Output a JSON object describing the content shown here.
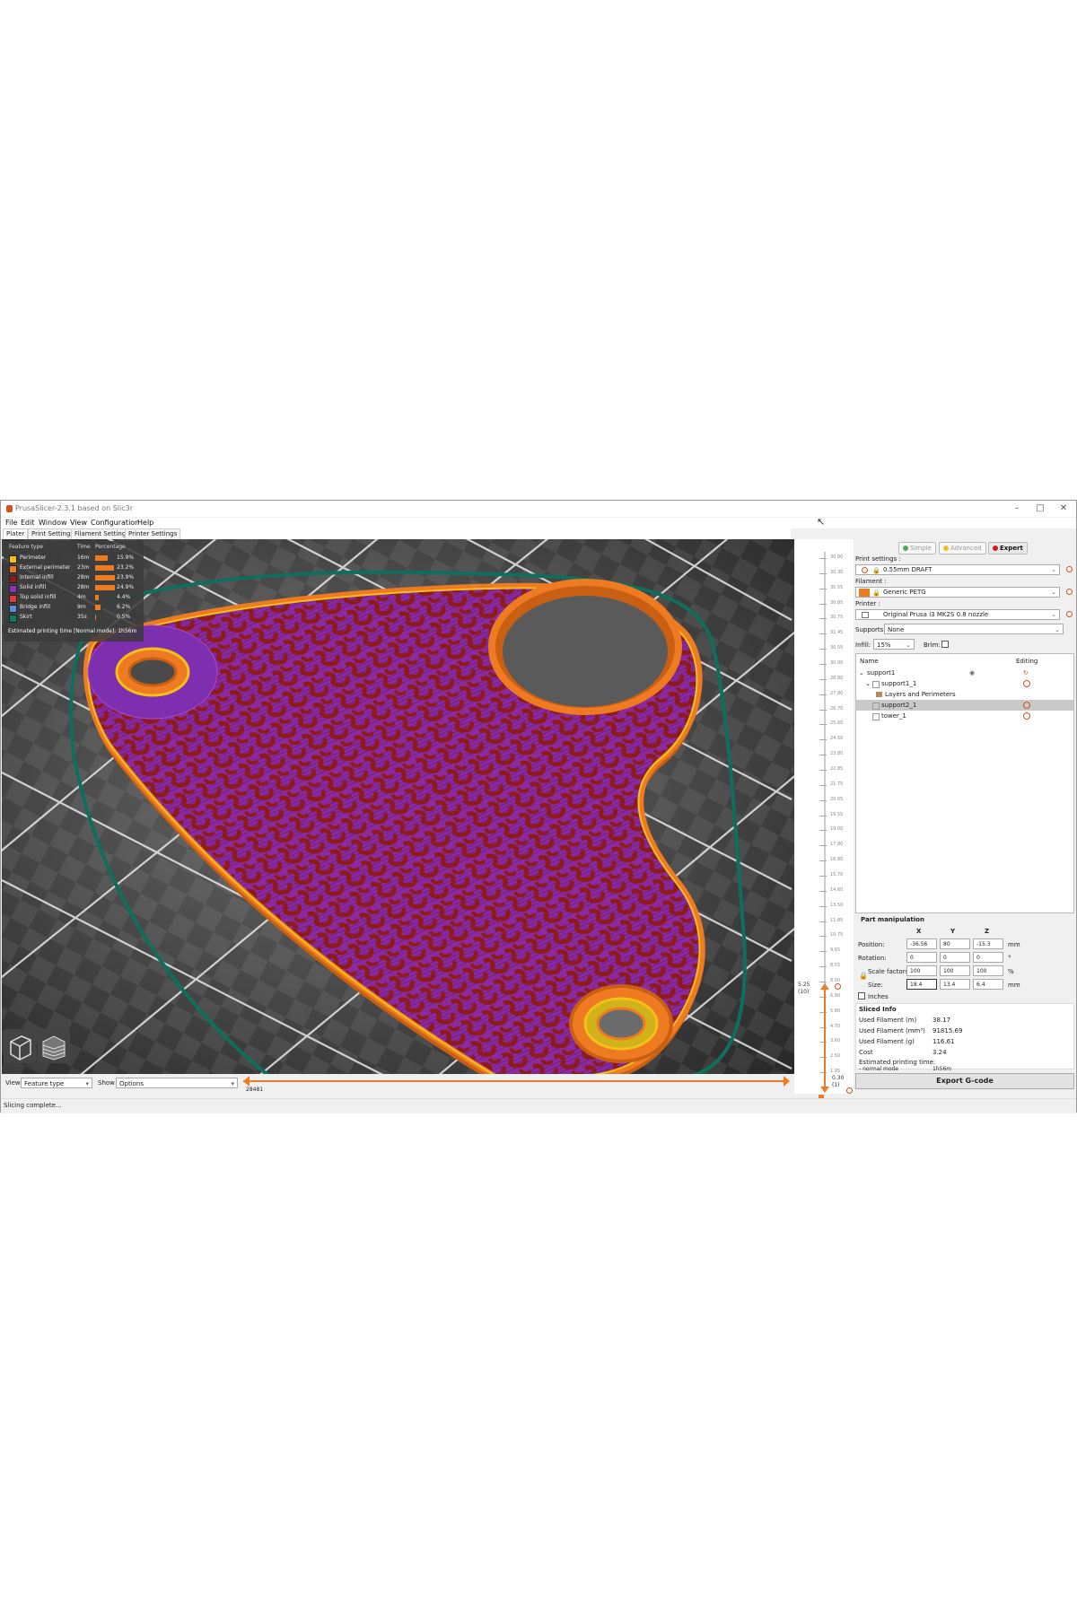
{
  "window": {
    "title": "PrusaSlicer-2.3.1 based on Slic3r",
    "controls": [
      "–",
      "□",
      "✕"
    ]
  },
  "menu": [
    "File",
    "Edit",
    "Window",
    "View",
    "Configuration",
    "Help"
  ],
  "tabs": [
    "Plater",
    "Print Settings",
    "Filament Settings",
    "Printer Settings"
  ],
  "legend": {
    "headers": [
      "Feature type",
      "Time",
      "Percentage"
    ],
    "rows": [
      {
        "label": "Perimeter",
        "time": "16m",
        "pct": "15.9%",
        "fraction": 0.159,
        "color": "#f3c019"
      },
      {
        "label": "External perimeter",
        "time": "23m",
        "pct": "23.2%",
        "fraction": 0.232,
        "color": "#ee7b22"
      },
      {
        "label": "Internal infill",
        "time": "28m",
        "pct": "23.9%",
        "fraction": 0.239,
        "color": "#8d1b1b"
      },
      {
        "label": "Solid infill",
        "time": "28m",
        "pct": "24.9%",
        "fraction": 0.249,
        "color": "#8f2fc4"
      },
      {
        "label": "Top solid infill",
        "time": "4m",
        "pct": "4.4%",
        "fraction": 0.044,
        "color": "#e23a3a"
      },
      {
        "label": "Bridge infill",
        "time": "9m",
        "pct": "6.2%",
        "fraction": 0.062,
        "color": "#5b8ed8"
      },
      {
        "label": "Skirt",
        "time": "35s",
        "pct": "0.5%",
        "fraction": 0.005,
        "color": "#0f7a66"
      }
    ],
    "estimate": "Estimated printing time [Normal mode]:  1h56m"
  },
  "bottombar": {
    "view_label": "View",
    "view_value": "Feature type",
    "show_label": "Show",
    "show_value": "Options",
    "h_left_value": "28481",
    "h_right_value": "30125"
  },
  "vslider": {
    "labels": [
      "30.80",
      "30.30",
      "30.55",
      "30.85",
      "30.75",
      "31.45",
      "30.55",
      "30.00",
      "28.80",
      "27.80",
      "26.70",
      "25.60",
      "24.50",
      "23.80",
      "22.85",
      "21.75",
      "20.65",
      "19.55",
      "19.00",
      "17.80",
      "16.80",
      "15.70",
      "14.60",
      "13.50",
      "11.85",
      "10.75",
      "9.65",
      "8.55",
      "8.00",
      "6.90",
      "5.80",
      "4.70",
      "3.60",
      "2.50",
      "1.95"
    ],
    "top_value": "5.25",
    "top_layer": "(10)",
    "bottom_value": "0.30",
    "bottom_layer": "(1)"
  },
  "panel": {
    "modes": [
      "Simple",
      "Advanced",
      "Expert"
    ],
    "print_settings_label": "Print settings :",
    "print_settings_value": "0.55mm DRAFT",
    "filament_label": "Filament :",
    "filament_value": "Generic PETG",
    "filament_color": "#ee7b22",
    "printer_label": "Printer :",
    "printer_value": "Original Prusa i3 MK2S 0.8 nozzle",
    "supports_label": "Supports:",
    "supports_value": "None",
    "infill_label": "Infill:",
    "infill_value": "15%",
    "brim_label": "Brim:",
    "tree": {
      "col_name": "Name",
      "col_editing": "Editing",
      "nodes": [
        "support1",
        "support1_1",
        "Layers and Perimeters",
        "support2_1",
        "tower_1"
      ]
    },
    "part_manipulation": {
      "title": "Part manipulation",
      "axes": [
        "X",
        "Y",
        "Z"
      ],
      "position_label": "Position:",
      "position": [
        "-36.56",
        "80",
        "-15.3"
      ],
      "position_unit": "mm",
      "rotation_label": "Rotation:",
      "rotation": [
        "0",
        "0",
        "0"
      ],
      "rotation_unit": "°",
      "scale_label": "Scale factors:",
      "scale": [
        "100",
        "100",
        "100"
      ],
      "scale_unit": "%",
      "size_label": "Size:",
      "size": [
        "18.4",
        "13.4",
        "6.4"
      ],
      "size_unit": "mm",
      "inches_label": "Inches"
    },
    "sliced_info": {
      "title": "Sliced Info",
      "rows": [
        {
          "label": "Used Filament (m)",
          "value": "38.17"
        },
        {
          "label": "Used Filament (mm³)",
          "value": "91815.69"
        },
        {
          "label": "Used Filament (g)",
          "value": "116.61"
        },
        {
          "label": "Cost",
          "value": "3.24"
        }
      ],
      "est_label": "Estimated printing time:",
      "normal_label": "- normal mode",
      "normal_value": "1h56m"
    },
    "export_label": "Export G-code"
  },
  "status": "Slicing complete..."
}
